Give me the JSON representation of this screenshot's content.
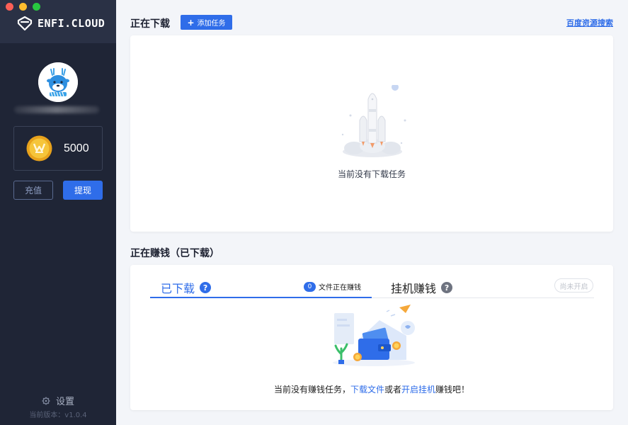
{
  "sidebar": {
    "logo_text": "ENFI.CLOUD",
    "balance": "5000",
    "recharge_label": "充值",
    "withdraw_label": "提现",
    "settings_label": "设置",
    "version_label": "当前版本：v1.0.4"
  },
  "download_section": {
    "title": "正在下载",
    "add_task_label": "添加任务",
    "baidu_search_label": "百度资源搜索",
    "empty_text": "当前没有下载任务"
  },
  "earn_section": {
    "title": "正在赚钱（已下载）",
    "tab_downloaded_label": "已下载",
    "files_earning_count": "0",
    "files_earning_label": "文件正在赚钱",
    "tab_idle_label": "挂机赚钱",
    "idle_status": "尚未开启",
    "empty_prefix": "当前没有赚钱任务，",
    "download_files_link": "下载文件",
    "or_text": "或者",
    "enable_idle_link": "开启挂机",
    "empty_suffix": "赚钱吧！"
  },
  "colors": {
    "sidebar_bg": "#1f2536",
    "accent": "#2f6de9",
    "main_bg": "#f3f5f9"
  }
}
